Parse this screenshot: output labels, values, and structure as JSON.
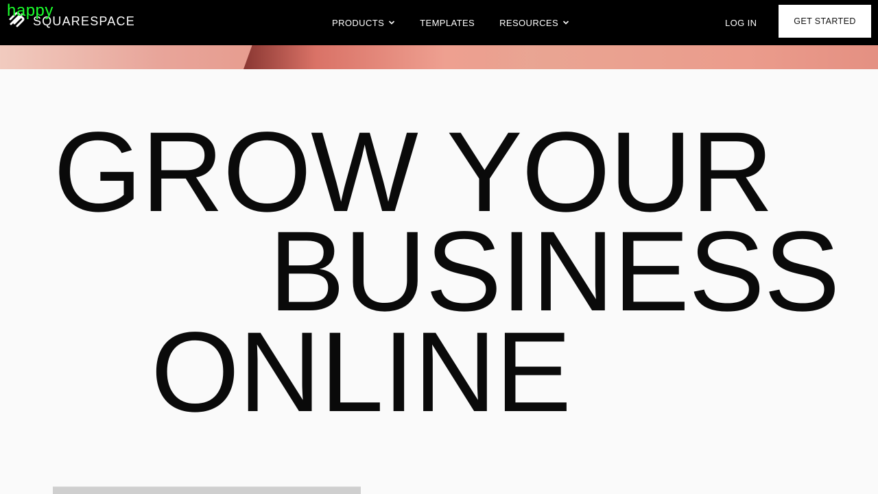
{
  "watermark": {
    "text": "happy"
  },
  "navbar": {
    "logo_text": "SQUARESPACE",
    "items": [
      {
        "label": "PRODUCTS",
        "icon": "chevron-down-icon"
      },
      {
        "label": "TEMPLATES"
      },
      {
        "label": "RESOURCES",
        "icon": "chevron-down-icon"
      }
    ],
    "login_label": "LOG IN",
    "cta_label": "GET STARTED"
  },
  "hero": {
    "headline_lines": [
      "GROW YOUR",
      "BUSINESS",
      "ONLINE"
    ]
  },
  "colors": {
    "nav_background": "#000000",
    "page_background": "#fafafa",
    "watermark": "#1cff2d"
  }
}
